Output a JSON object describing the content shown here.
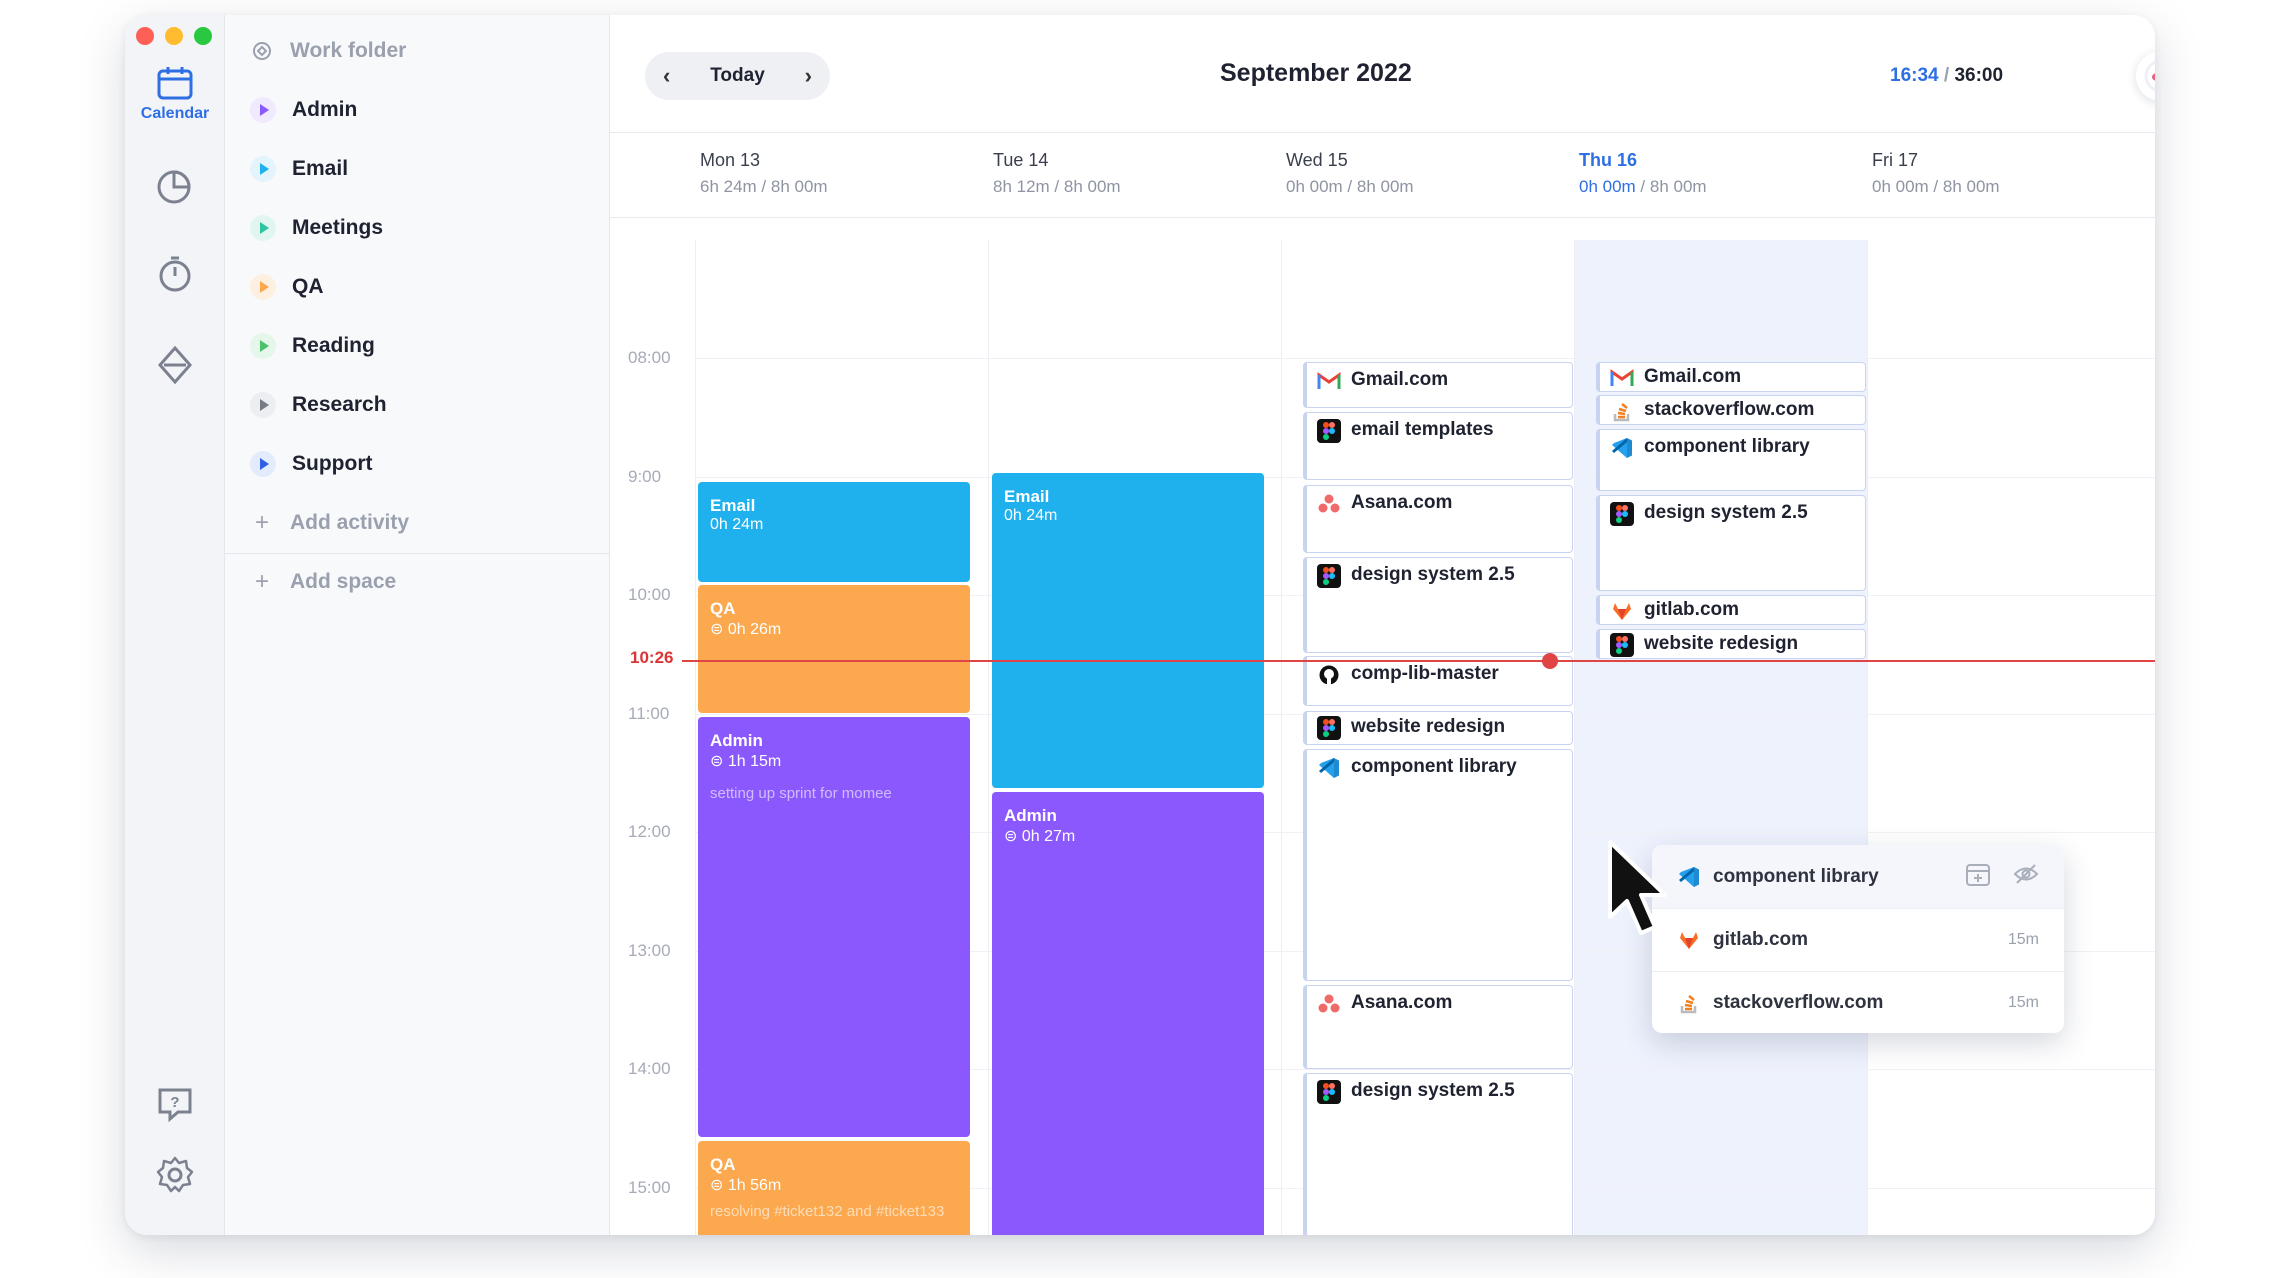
{
  "window": {
    "traffic_lights": [
      "#fe5f57",
      "#febc2e",
      "#28c840"
    ]
  },
  "rail": {
    "calendar_label": "Calendar",
    "icons": [
      "calendar-icon",
      "pie-chart-icon",
      "clock-icon",
      "diamond-icon",
      "help-icon",
      "gear-icon"
    ]
  },
  "sidebar": {
    "folder": "Work folder",
    "activities": [
      {
        "label": "Admin",
        "color": "#8b58fd"
      },
      {
        "label": "Email",
        "color": "#1fb0ee"
      },
      {
        "label": "Meetings",
        "color": "#2fc4a2"
      },
      {
        "label": "QA",
        "color": "#fba84e"
      },
      {
        "label": "Reading",
        "color": "#4cc26b"
      },
      {
        "label": "Research",
        "color": "#777b86"
      },
      {
        "label": "Support",
        "color": "#2f5ee8"
      }
    ],
    "add_activity": "Add activity",
    "add_space": "Add space"
  },
  "header": {
    "today": "Today",
    "month": "September 2022",
    "timer_current": "16:34",
    "timer_sep": " / ",
    "timer_total": "36:00"
  },
  "days": [
    {
      "name": "Mon 13",
      "tracked": "6h 24m",
      "sep": " / ",
      "target": "8h 00m"
    },
    {
      "name": "Tue 14",
      "tracked": "8h 12m",
      "sep": " / ",
      "target": "8h 00m"
    },
    {
      "name": "Wed 15",
      "tracked": "0h 00m",
      "sep": " / ",
      "target": "8h 00m"
    },
    {
      "name": "Thu 16",
      "tracked": "0h 00m",
      "sep": " / ",
      "target": "8h 00m"
    },
    {
      "name": "Fri 17",
      "tracked": "0h 00m",
      "sep": " / ",
      "target": "8h 00m"
    }
  ],
  "hours": [
    "08:00",
    "9:00",
    "10:00",
    "11:00",
    "12:00",
    "13:00",
    "14:00",
    "15:00"
  ],
  "now": "10:26",
  "events": {
    "mon": [
      {
        "title": "Email",
        "duration": "0h 24m",
        "note": ""
      },
      {
        "title": "QA",
        "duration": "0h 26m",
        "note": ""
      },
      {
        "title": "Admin",
        "duration": "1h 15m",
        "note": "setting up sprint for momee"
      },
      {
        "title": "QA",
        "duration": "1h 56m",
        "note": "resolving #ticket132 and #ticket133"
      }
    ],
    "tue": [
      {
        "title": "Email",
        "duration": "0h 24m"
      },
      {
        "title": "Admin",
        "duration": "0h 27m"
      }
    ]
  },
  "apps": {
    "wed": [
      "Gmail.com",
      "email templates",
      "Asana.com",
      "design system 2.5",
      "comp-lib-master",
      "website redesign",
      "component library",
      "Asana.com",
      "design system 2.5"
    ],
    "thu": [
      "Gmail.com",
      "stackoverflow.com",
      "component library",
      "design system 2.5",
      "gitlab.com",
      "website redesign"
    ]
  },
  "popup": {
    "items": [
      {
        "label": "component library",
        "duration": ""
      },
      {
        "label": "gitlab.com",
        "duration": "15m"
      },
      {
        "label": "stackoverflow.com",
        "duration": "15m"
      }
    ]
  }
}
